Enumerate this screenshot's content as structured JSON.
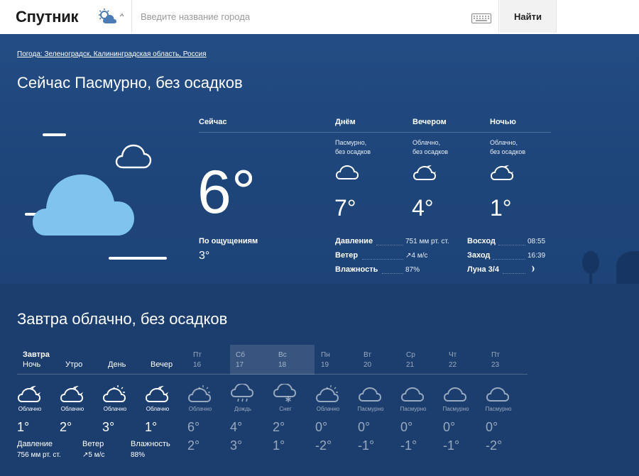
{
  "header": {
    "logo": "Спутник",
    "search_placeholder": "Введите название города",
    "search_button": "Найти"
  },
  "breadcrumb": "Погода: Зеленоградск, Калининградская область, Россия",
  "now_title": "Сейчас Пасмурно, без осадков",
  "now": {
    "label": "Сейчас",
    "temp": "6°",
    "feels_label": "По ощущениям",
    "feels_value": "3°"
  },
  "parts": [
    {
      "label": "Днём",
      "desc1": "Пасмурно,",
      "desc2": "без осадков",
      "temp": "7°",
      "icon": "cloud-icon"
    },
    {
      "label": "Вечером",
      "desc1": "Облачно,",
      "desc2": "без осадков",
      "temp": "4°",
      "icon": "cloud-moon-icon"
    },
    {
      "label": "Ночью",
      "desc1": "Облачно,",
      "desc2": "без осадков",
      "temp": "1°",
      "icon": "cloud-moon-icon"
    }
  ],
  "details": {
    "pressure_label": "Давление",
    "pressure_value": "751 мм рт. ст.",
    "wind_label": "Ветер",
    "wind_value": "↗4 м/с",
    "humidity_label": "Влажность",
    "humidity_value": "87%",
    "sunrise_label": "Восход",
    "sunrise_value": "08:55",
    "sunset_label": "Заход",
    "sunset_value": "16:39",
    "moon_label": "Луна 3/4"
  },
  "tomorrow_title": "Завтра облачно, без осадков",
  "forecast": {
    "tomorrow_label": "Завтра",
    "periods": [
      "Ночь",
      "Утро",
      "День",
      "Вечер"
    ],
    "days": [
      {
        "name": "Пт",
        "date": "16"
      },
      {
        "name": "Сб",
        "date": "17"
      },
      {
        "name": "Вс",
        "date": "18"
      },
      {
        "name": "Пн",
        "date": "19"
      },
      {
        "name": "Вт",
        "date": "20"
      },
      {
        "name": "Ср",
        "date": "21"
      },
      {
        "name": "Чт",
        "date": "22"
      },
      {
        "name": "Пт",
        "date": "23"
      }
    ],
    "cells": [
      {
        "desc": "Облачно",
        "t1": "1°",
        "t2": "",
        "icon": "cloud-moon-icon"
      },
      {
        "desc": "Облачно",
        "t1": "2°",
        "t2": "",
        "icon": "cloud-moon-icon"
      },
      {
        "desc": "Облачно",
        "t1": "3°",
        "t2": "",
        "icon": "cloud-sun-icon"
      },
      {
        "desc": "Облачно",
        "t1": "1°",
        "t2": "",
        "icon": "cloud-moon-icon"
      },
      {
        "desc": "Облачно",
        "t1": "6°",
        "t2": "2°",
        "icon": "cloud-sun-icon"
      },
      {
        "desc": "Дождь",
        "t1": "4°",
        "t2": "3°",
        "icon": "rain-icon"
      },
      {
        "desc": "Снег",
        "t1": "2°",
        "t2": "1°",
        "icon": "snow-icon"
      },
      {
        "desc": "Облачно",
        "t1": "0°",
        "t2": "-2°",
        "icon": "cloud-sun-icon"
      },
      {
        "desc": "Пасмурно",
        "t1": "0°",
        "t2": "-1°",
        "icon": "cloud-icon"
      },
      {
        "desc": "Пасмурно",
        "t1": "0°",
        "t2": "-1°",
        "icon": "cloud-icon"
      },
      {
        "desc": "Пасмурно",
        "t1": "0°",
        "t2": "-1°",
        "icon": "cloud-icon"
      },
      {
        "desc": "Пасмурно",
        "t1": "0°",
        "t2": "-2°",
        "icon": "cloud-icon"
      }
    ],
    "pressure_label": "Давление",
    "pressure_value": "756 мм рт. ст.",
    "wind_label": "Ветер",
    "wind_value": "↗5 м/с",
    "humidity_label": "Влажность",
    "humidity_value": "88%"
  }
}
